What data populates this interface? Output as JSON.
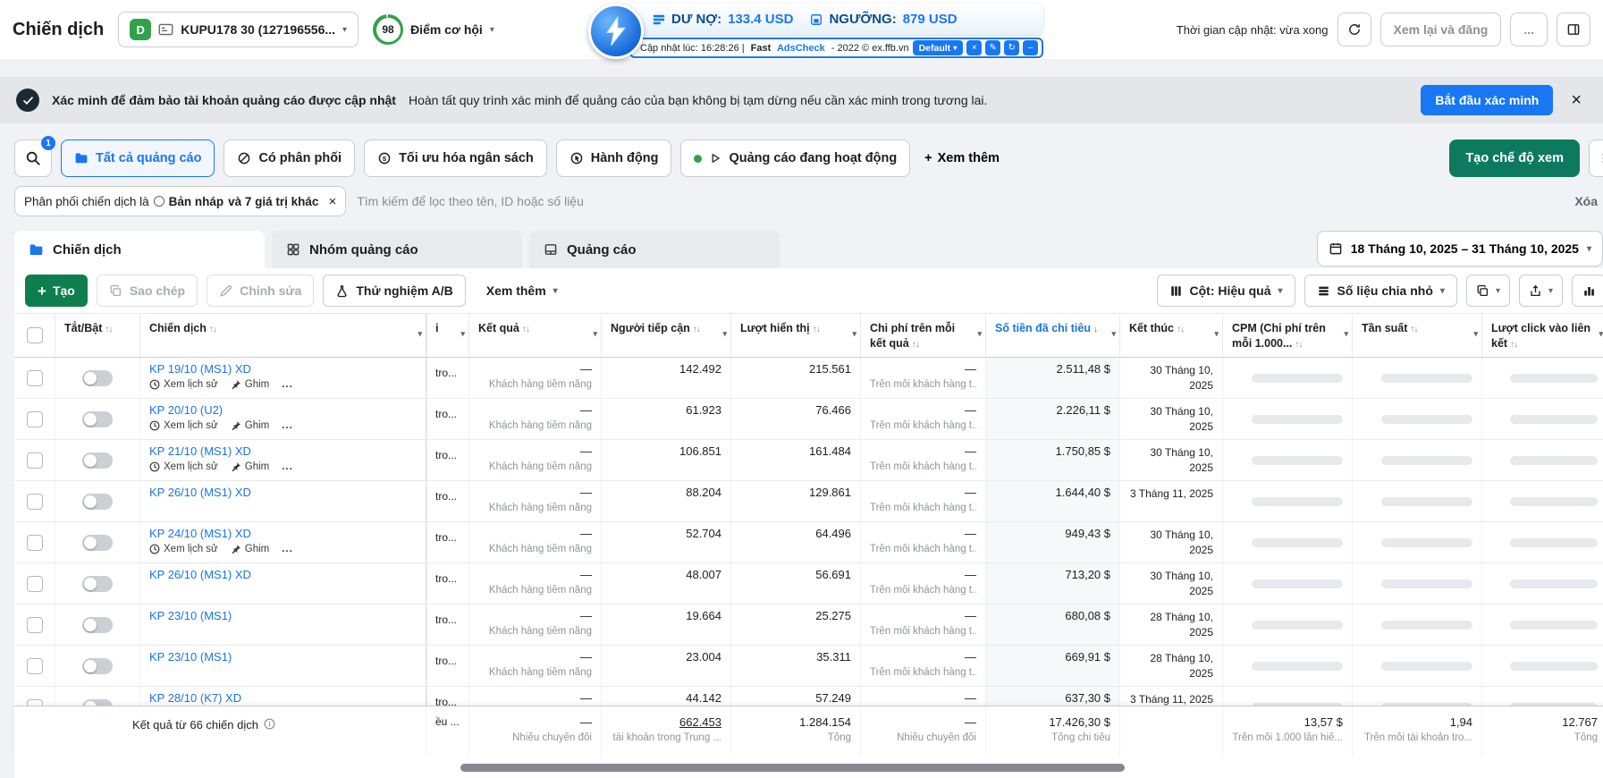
{
  "colors": {
    "accent_blue": "#1877f2",
    "link_blue": "#1b74e4",
    "create_green": "#0e7e4f",
    "create_view_teal": "#0d7a60",
    "banner_bg": "#e4e6ea",
    "account_badge_green": "#31a24c"
  },
  "glyphs": {
    "caret": "▾",
    "close": "×",
    "plus": "+",
    "dots": "..."
  },
  "top_bar": {
    "page_title": "Chiến dịch",
    "account": {
      "initial": "D",
      "name": "KUPU178 30 (127196556..."
    },
    "score": {
      "value": "98",
      "label": "Điểm cơ hội"
    },
    "refresh_status": "Thời gian cập nhật: vừa xong",
    "review_publish": "Xem lại và đăng",
    "more": "..."
  },
  "extension": {
    "balance_label": "DƯ NỢ:",
    "balance_value": "133.4 USD",
    "threshold_label": "NGƯỠNG:",
    "threshold_value": "879 USD",
    "updated_prefix": "Cập nhật lúc: 16:28:26 | ",
    "brand_a": "Fast",
    "brand_b": " AdsCheck",
    "meta": " - 2022 © ex.ffb.vn",
    "profile_button": "Default"
  },
  "verify_banner": {
    "title": "Xác minh để đảm bảo tài khoản quảng cáo được cập nhật",
    "body": "Hoàn tất quy trình xác minh để quảng cáo của bạn không bị tạm dừng nếu cần xác minh trong tương lai.",
    "cta": "Bắt đầu xác minh"
  },
  "filter_bar": {
    "search_count": "1",
    "pills": [
      {
        "label": "Tất cả quảng cáo"
      },
      {
        "label": "Có phân phối"
      },
      {
        "label": "Tối ưu hóa ngân sách"
      },
      {
        "label": "Hành động"
      },
      {
        "label": "Quảng cáo đang hoạt động"
      }
    ],
    "more_label": "Xem thêm",
    "create_view_label": "Tạo chế độ xem"
  },
  "chip_row": {
    "chip": {
      "prefix": "Phân phối chiến dịch là",
      "value": "Bản nháp",
      "suffix": "và 7 giá trị khác"
    },
    "search_placeholder": "Tìm kiếm để lọc theo tên, ID hoặc số liệu",
    "clear_label": "Xóa"
  },
  "tabs": [
    {
      "label": "Chiến dịch"
    },
    {
      "label": "Nhóm quảng cáo"
    },
    {
      "label": "Quảng cáo"
    }
  ],
  "date_range": "18 Tháng 10, 2025 – 31 Tháng 10, 2025",
  "toolbar": {
    "create": "Tạo",
    "duplicate": "Sao chép",
    "edit": "Chỉnh sửa",
    "ab_test": "Thử nghiệm A/B",
    "more": "Xem thêm",
    "columns": "Cột: Hiệu quả",
    "breakdown": "Số liệu chia nhỏ"
  },
  "table": {
    "headers": [
      {
        "id": "toggle",
        "label": "Tắt/Bật",
        "sort": "↑↓"
      },
      {
        "id": "name",
        "label": "Chiến dịch",
        "sort": "↑↓",
        "caret": true
      },
      {
        "id": "delivery",
        "label": "i",
        "caret": true
      },
      {
        "id": "result",
        "label": "Kết quả",
        "sort": "↑↓",
        "caret": true
      },
      {
        "id": "reach",
        "label": "Người tiếp cận",
        "sort": "↑↓",
        "caret": true
      },
      {
        "id": "impressions",
        "label": "Lượt hiển thị",
        "sort": "↑↓",
        "caret": true
      },
      {
        "id": "cost",
        "label": "Chi phí trên mỗi kết quả",
        "sort": "↑↓",
        "caret": true
      },
      {
        "id": "spent",
        "label": "Số tiền đã chi tiêu",
        "sort": "↓",
        "sorted": true,
        "caret": true
      },
      {
        "id": "end",
        "label": "Kết thúc",
        "sort": "↑↓",
        "caret": true
      },
      {
        "id": "cpm",
        "label": "CPM (Chi phí trên mỗi 1.000...",
        "sort": "↑↓",
        "caret": true
      },
      {
        "id": "freq",
        "label": "Tần suất",
        "sort": "↑↓",
        "caret": true
      },
      {
        "id": "clicks",
        "label": "Lượt click vào liên kết",
        "sort": "↑↓",
        "caret": true
      }
    ],
    "row_defaults": {
      "delivery": "tro...",
      "result": "—",
      "result_sub": "Khách hàng tiềm năng",
      "cost": "—",
      "cost_sub": "Trên mỗi khách hàng t...",
      "history_label": "Xem lịch sử",
      "pin_label": "Ghim",
      "dots": "..."
    },
    "rows": [
      {
        "name": "KP 19/10 (MS1) XD",
        "history": true,
        "reach": "142.492",
        "impressions": "215.561",
        "spent": "2.511,48 $",
        "end": "30 Tháng 10, 2025"
      },
      {
        "name": "KP 20/10 (U2)",
        "history": true,
        "reach": "61.923",
        "impressions": "76.466",
        "spent": "2.226,11 $",
        "end": "30 Tháng 10, 2025"
      },
      {
        "name": "KP 21/10 (MS1) XD",
        "history": true,
        "reach": "106.851",
        "impressions": "161.484",
        "spent": "1.750,85 $",
        "end": "30 Tháng 10, 2025"
      },
      {
        "name": "KP 26/10 (MS1) XD",
        "history": false,
        "reach": "88.204",
        "impressions": "129.861",
        "spent": "1.644,40 $",
        "end": "3 Tháng 11, 2025"
      },
      {
        "name": "KP 24/10 (MS1) XD",
        "history": true,
        "reach": "52.704",
        "impressions": "64.496",
        "spent": "949,43 $",
        "end": "30 Tháng 10, 2025"
      },
      {
        "name": "KP 26/10 (MS1) XD",
        "history": false,
        "reach": "48.007",
        "impressions": "56.691",
        "spent": "713,20 $",
        "end": "30 Tháng 10, 2025"
      },
      {
        "name": "KP 23/10 (MS1)",
        "history": false,
        "reach": "19.664",
        "impressions": "25.275",
        "spent": "680,08 $",
        "end": "28 Tháng 10, 2025"
      },
      {
        "name": "KP 23/10 (MS1)",
        "history": false,
        "reach": "23.004",
        "impressions": "35.311",
        "spent": "669,91 $",
        "end": "28 Tháng 10, 2025"
      },
      {
        "name": "KP 28/10 (K7) XD",
        "history": false,
        "reach": "44.142",
        "impressions": "57.249",
        "spent": "637,30 $",
        "end": "3 Tháng 11, 2025"
      }
    ],
    "footer": {
      "summary": "Kết quả từ 66 chiến dịch",
      "delivery": "ều ...",
      "result": "—",
      "result_sub": "Nhiều chuyển đổi",
      "reach": "662.453",
      "reach_sub": "tài khoản trong Trung ...",
      "impressions": "1.284.154",
      "impressions_sub": "Tổng",
      "cost": "—",
      "cost_sub": "Nhiều chuyển đổi",
      "spent": "17.426,30 $",
      "spent_sub": "Tổng chi tiêu",
      "cpm": "13,57 $",
      "cpm_sub": "Trên mỗi 1.000 lần hiể...",
      "freq": "1,94",
      "freq_sub": "Trên mỗi tài khoản tro...",
      "clicks": "12.767",
      "clicks_sub": "Tổng"
    }
  }
}
